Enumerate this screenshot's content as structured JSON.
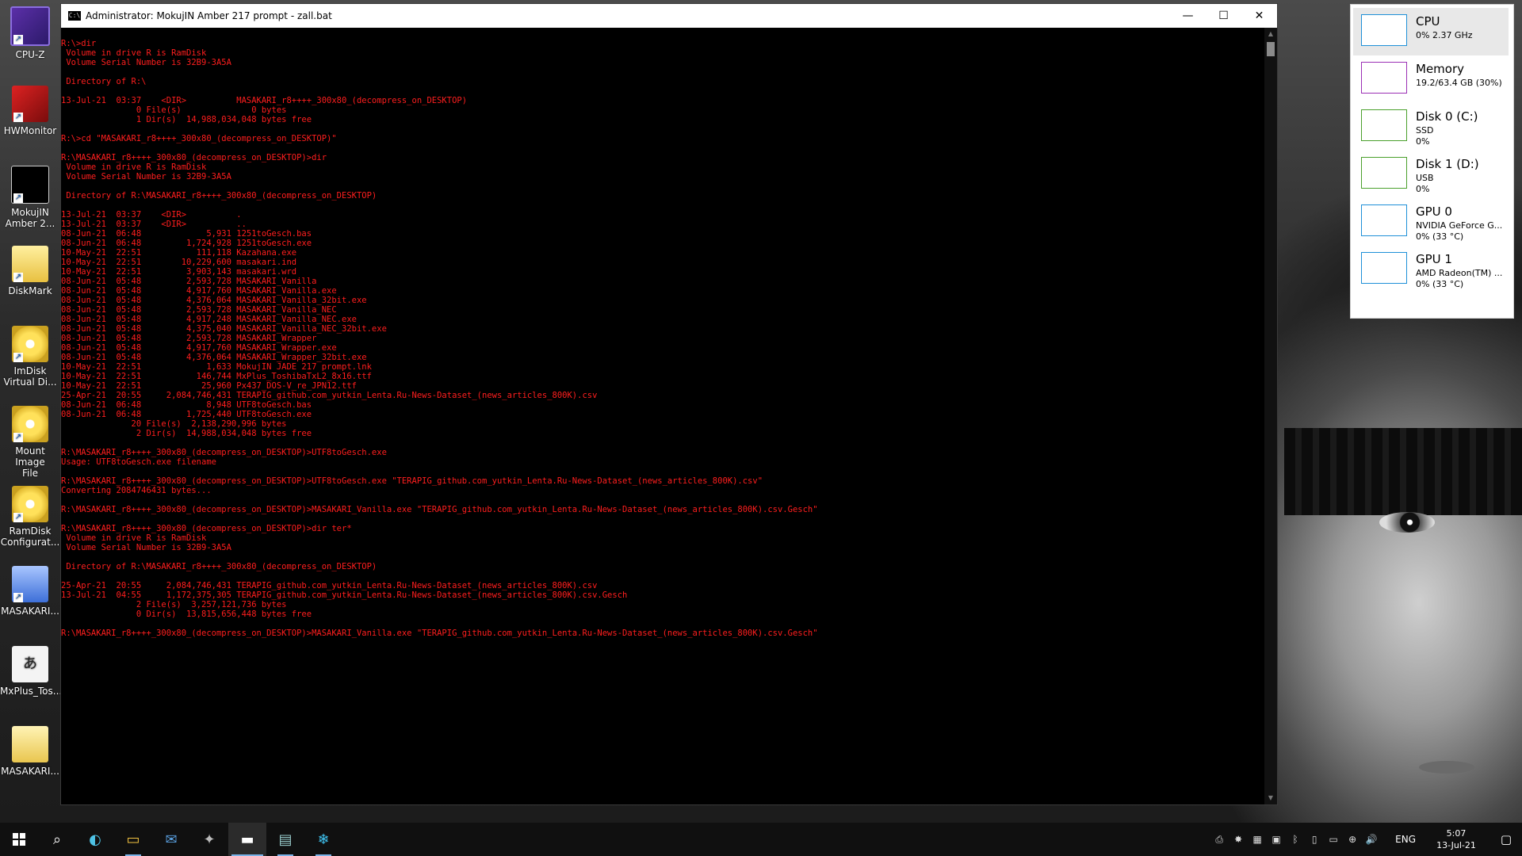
{
  "desktop_icons": [
    {
      "label_lines": [
        "CPU-Z"
      ],
      "icon": "cpuz-icon"
    },
    {
      "label_lines": [
        "HWMonitor"
      ],
      "icon": "hwmonitor-icon"
    },
    {
      "label_lines": [
        "MokujIN",
        "Amber 2..."
      ],
      "icon": "mokujin-icon"
    },
    {
      "label_lines": [
        "DiskMark"
      ],
      "icon": "diskmark-icon"
    },
    {
      "label_lines": [
        "ImDisk",
        "Virtual Di..."
      ],
      "icon": "imdisk-icon"
    },
    {
      "label_lines": [
        "Mount Image",
        "File"
      ],
      "icon": "mount-image-icon"
    },
    {
      "label_lines": [
        "RamDisk",
        "Configurat..."
      ],
      "icon": "ramdisk-icon"
    },
    {
      "label_lines": [
        "MASAKARI..."
      ],
      "icon": "masakari-icon"
    },
    {
      "label_lines": [
        "MxPlus_Tos..."
      ],
      "icon": "font-file-icon",
      "glyph": "あ"
    },
    {
      "label_lines": [
        "MASAKARI..."
      ],
      "icon": "folder-icon"
    }
  ],
  "console": {
    "title": "Administrator: MokujIN Amber 217 prompt - zall.bat",
    "icon_glyph": "C:\\",
    "minimize": "—",
    "maximize": "☐",
    "close": "✕",
    "lines": [
      "R:\\>dir",
      " Volume in drive R is RamDisk",
      " Volume Serial Number is 32B9-3A5A",
      "",
      " Directory of R:\\",
      "",
      "13-Jul-21  03:37    <DIR>          MASAKARI_r8++++_300x80_(decompress_on_DESKTOP)",
      "               0 File(s)              0 bytes",
      "               1 Dir(s)  14,988,034,048 bytes free",
      "",
      "R:\\>cd \"MASAKARI_r8++++_300x80_(decompress_on_DESKTOP)\"",
      "",
      "R:\\MASAKARI_r8++++_300x80_(decompress_on_DESKTOP)>dir",
      " Volume in drive R is RamDisk",
      " Volume Serial Number is 32B9-3A5A",
      "",
      " Directory of R:\\MASAKARI_r8++++_300x80_(decompress_on_DESKTOP)",
      "",
      "13-Jul-21  03:37    <DIR>          .",
      "13-Jul-21  03:37    <DIR>          ..",
      "08-Jun-21  06:48             5,931 1251toGesch.bas",
      "08-Jun-21  06:48         1,724,928 1251toGesch.exe",
      "10-May-21  22:51           111,118 Kazahana.exe",
      "10-May-21  22:51        10,229,600 masakari.ind",
      "10-May-21  22:51         3,903,143 masakari.wrd",
      "08-Jun-21  05:48         2,593,728 MASAKARI_Vanilla",
      "08-Jun-21  05:48         4,917,760 MASAKARI_Vanilla.exe",
      "08-Jun-21  05:48         4,376,064 MASAKARI_Vanilla_32bit.exe",
      "08-Jun-21  05:48         2,593,728 MASAKARI_Vanilla_NEC",
      "08-Jun-21  05:48         4,917,248 MASAKARI_Vanilla_NEC.exe",
      "08-Jun-21  05:48         4,375,040 MASAKARI_Vanilla_NEC_32bit.exe",
      "08-Jun-21  05:48         2,593,728 MASAKARI_Wrapper",
      "08-Jun-21  05:48         4,917,760 MASAKARI_Wrapper.exe",
      "08-Jun-21  05:48         4,376,064 MASAKARI_Wrapper_32bit.exe",
      "10-May-21  22:51             1,633 MokujIN JADE 217 prompt.lnk",
      "10-May-21  22:51           146,744 MxPlus_ToshibaTxL2_8x16.ttf",
      "10-May-21  22:51            25,960 Px437_DOS-V_re_JPN12.ttf",
      "25-Apr-21  20:55     2,084,746,431 TERAPIG_github.com_yutkin_Lenta.Ru-News-Dataset_(news_articles_800K).csv",
      "08-Jun-21  06:48             8,948 UTF8toGesch.bas",
      "08-Jun-21  06:48         1,725,440 UTF8toGesch.exe",
      "              20 File(s)  2,138,290,996 bytes",
      "               2 Dir(s)  14,988,034,048 bytes free",
      "",
      "R:\\MASAKARI_r8++++_300x80_(decompress_on_DESKTOP)>UTF8toGesch.exe",
      "Usage: UTF8toGesch.exe filename",
      "",
      "R:\\MASAKARI_r8++++_300x80_(decompress_on_DESKTOP)>UTF8toGesch.exe \"TERAPIG_github.com_yutkin_Lenta.Ru-News-Dataset_(news_articles_800K).csv\"",
      "Converting 2084746431 bytes...",
      "",
      "R:\\MASAKARI_r8++++_300x80_(decompress_on_DESKTOP)>MASAKARI_Vanilla.exe \"TERAPIG_github.com_yutkin_Lenta.Ru-News-Dataset_(news_articles_800K).csv.Gesch\"",
      "",
      "R:\\MASAKARI_r8++++_300x80_(decompress_on_DESKTOP)>dir ter*",
      " Volume in drive R is RamDisk",
      " Volume Serial Number is 32B9-3A5A",
      "",
      " Directory of R:\\MASAKARI_r8++++_300x80_(decompress_on_DESKTOP)",
      "",
      "25-Apr-21  20:55     2,084,746,431 TERAPIG_github.com_yutkin_Lenta.Ru-News-Dataset_(news_articles_800K).csv",
      "13-Jul-21  04:55     1,172,375,305 TERAPIG_github.com_yutkin_Lenta.Ru-News-Dataset_(news_articles_800K).csv.Gesch",
      "               2 File(s)  3,257,121,736 bytes",
      "               0 Dir(s)  13,815,656,448 bytes free",
      "",
      "R:\\MASAKARI_r8++++_300x80_(decompress_on_DESKTOP)>MASAKARI_Vanilla.exe \"TERAPIG_github.com_yutkin_Lenta.Ru-News-Dataset_(news_articles_800K).csv.Gesch\""
    ]
  },
  "perf_widget": {
    "items": [
      {
        "name": "CPU",
        "sub": "0% 2.37 GHz",
        "sub2": "",
        "color": "#1e90d8",
        "selected": true
      },
      {
        "name": "Memory",
        "sub": "19.2/63.4 GB (30%)",
        "sub2": "",
        "color": "#9b2fb5",
        "selected": false
      },
      {
        "name": "Disk 0 (C:)",
        "sub": "SSD",
        "sub2": "0%",
        "color": "#4aa02c",
        "selected": false
      },
      {
        "name": "Disk 1 (D:)",
        "sub": "USB",
        "sub2": "0%",
        "color": "#4aa02c",
        "selected": false
      },
      {
        "name": "GPU 0",
        "sub": "NVIDIA GeForce G...",
        "sub2": "0% (33 °C)",
        "color": "#1e90d8",
        "selected": false
      },
      {
        "name": "GPU 1",
        "sub": "AMD Radeon(TM) ...",
        "sub2": "0% (33 °C)",
        "color": "#1e90d8",
        "selected": false
      }
    ]
  },
  "taskbar": {
    "apps": [
      {
        "name": "search-icon",
        "glyph": "⌕"
      },
      {
        "name": "edge-icon",
        "glyph": "◐"
      },
      {
        "name": "file-explorer-icon",
        "glyph": "▭"
      },
      {
        "name": "mail-icon",
        "glyph": "✉"
      },
      {
        "name": "app-icon",
        "glyph": "✦"
      },
      {
        "name": "command-prompt-icon",
        "glyph": "▬"
      },
      {
        "name": "task-manager-icon",
        "glyph": "▤"
      },
      {
        "name": "snowflake-app-icon",
        "glyph": "❄"
      }
    ],
    "tray_icons": [
      "⎙",
      "✸",
      "▦",
      "▣",
      "ᛒ",
      "▯",
      "▭",
      "⊕",
      "🔊"
    ],
    "language": "ENG",
    "time": "5:07",
    "date": "13-Jul-21",
    "notification_glyph": "▢"
  }
}
